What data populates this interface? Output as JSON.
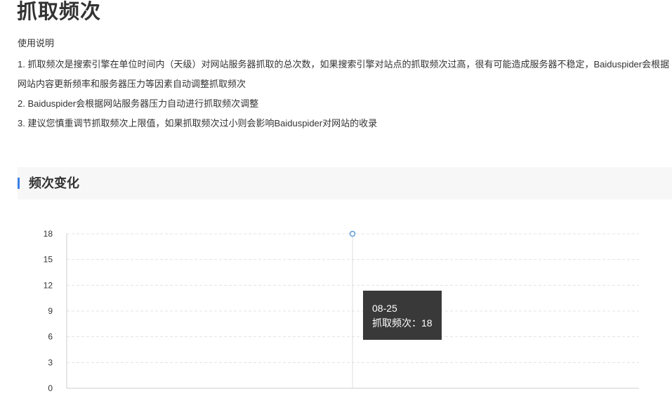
{
  "page": {
    "title": "抓取频次"
  },
  "instructions": {
    "heading": "使用说明",
    "items": [
      "1. 抓取频次是搜索引擎在单位时间内（天级）对网站服务器抓取的总次数，如果搜索引擎对站点的抓取频次过高，很有可能造成服务器不稳定，Baiduspider会根据网站内容更新频率和服务器压力等因素自动调整抓取频次",
      "2. Baiduspider会根据网站服务器压力自动进行抓取频次调整",
      "3. 建议您慎重调节抓取频次上限值，如果抓取频次过小则会影响Baiduspider对网站的收录"
    ]
  },
  "section": {
    "title": "频次变化"
  },
  "chart_data": {
    "type": "line",
    "ylim": [
      0,
      18
    ],
    "yticks": [
      "0",
      "3",
      "6",
      "9",
      "12",
      "15",
      "18"
    ],
    "x": [
      "08-25"
    ],
    "series": [
      {
        "values": [
          18
        ]
      }
    ],
    "grid": true,
    "colors": {
      "line": "#5b9bd5",
      "grid": "#e3e3e3",
      "axis": "#cccccc"
    }
  },
  "tooltip": {
    "date": "08-25",
    "label": "抓取频次：18"
  }
}
